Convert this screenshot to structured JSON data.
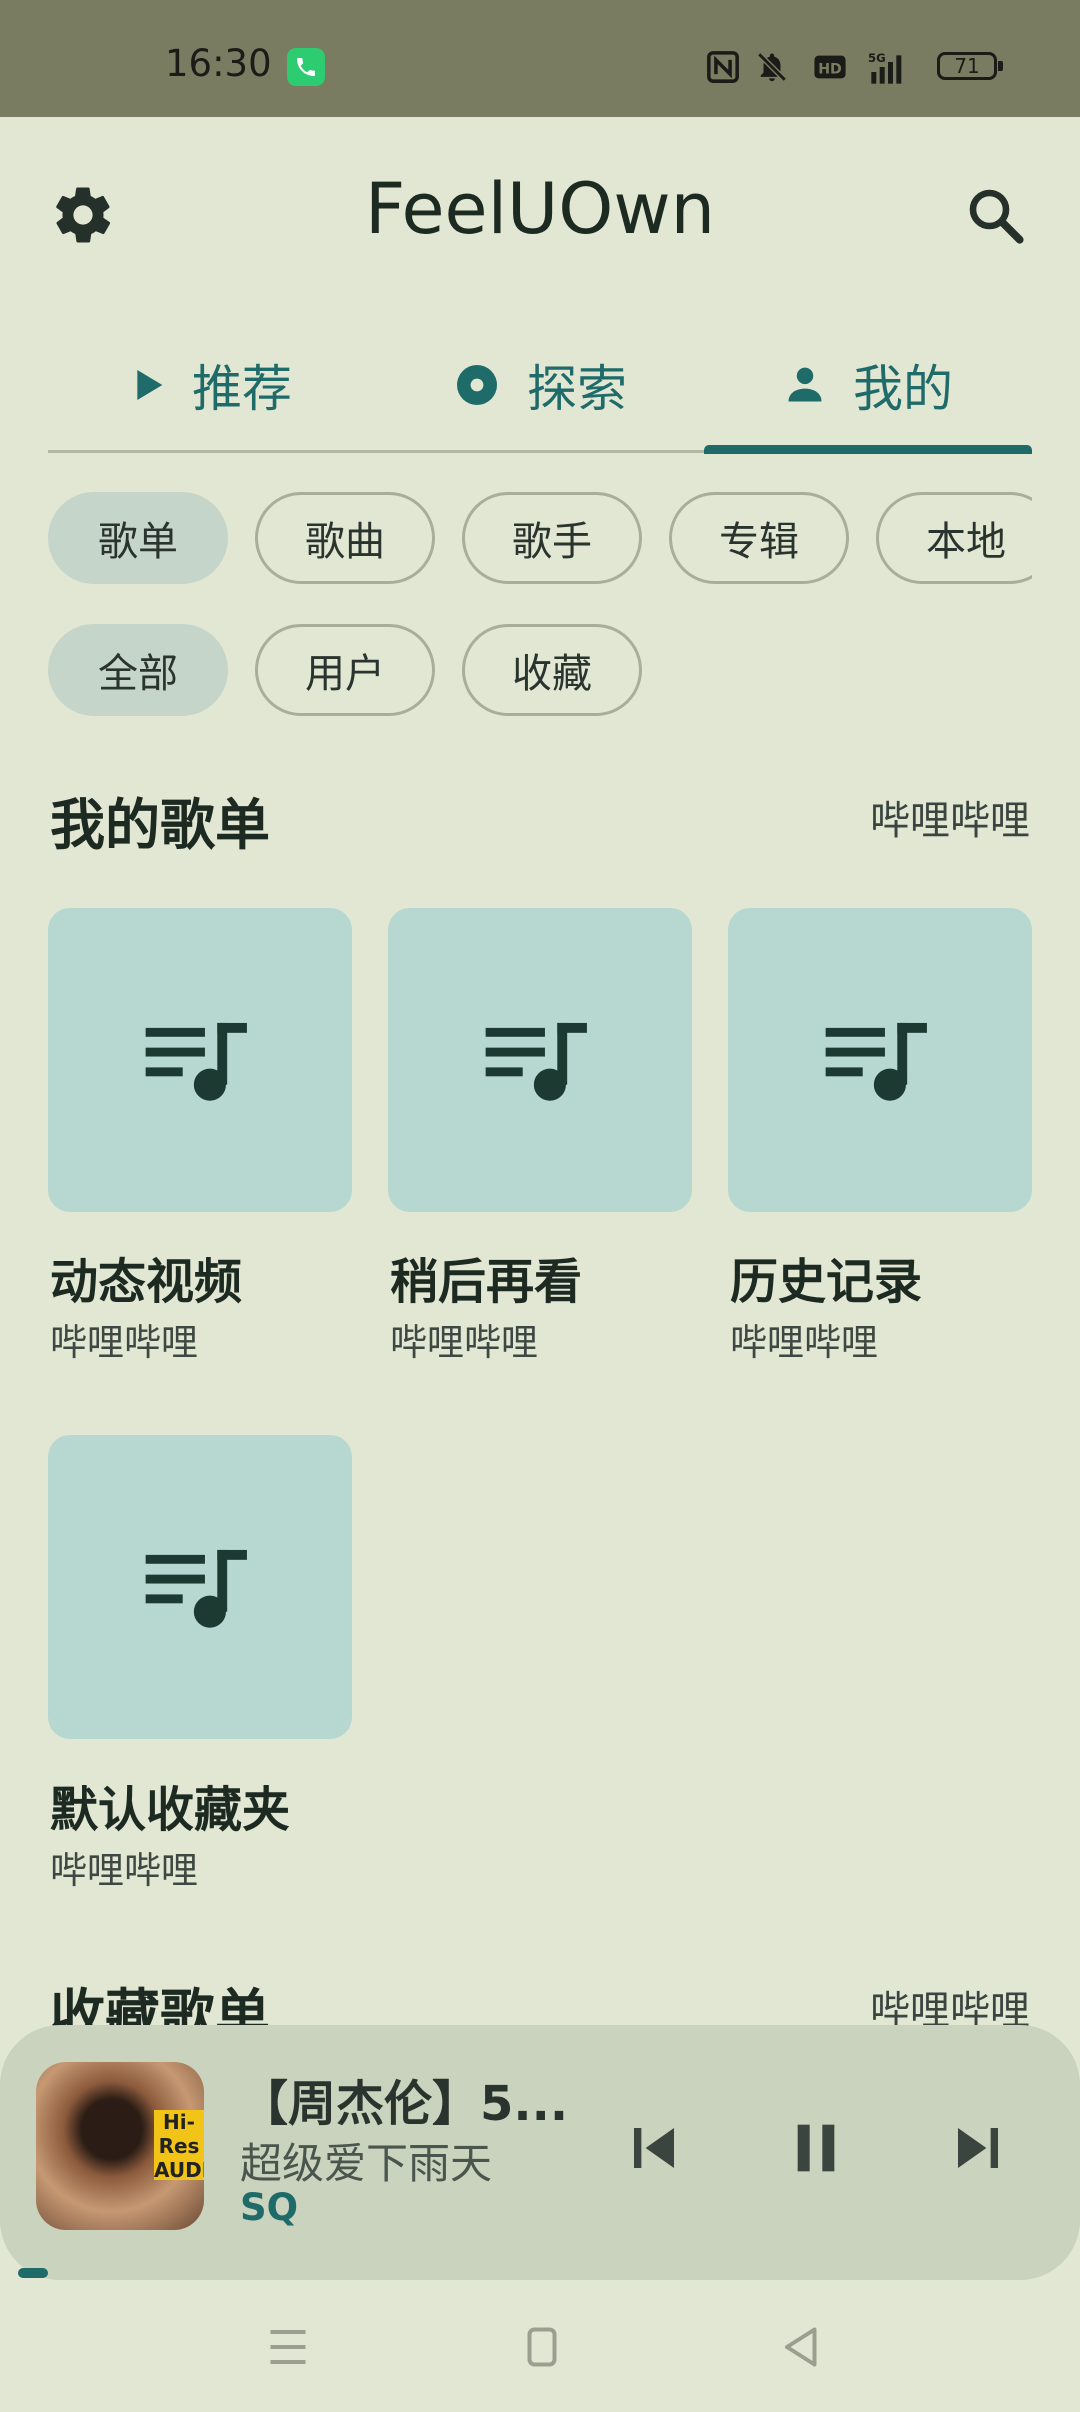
{
  "status_bar": {
    "time": "16:30",
    "network": "5G",
    "battery": "71",
    "icons": [
      "phone-call-icon",
      "nfc-icon",
      "bell-mute-icon",
      "hd-icon",
      "signal-5g-icon",
      "battery-icon"
    ]
  },
  "app_bar": {
    "title": "FeelUOwn",
    "settings_icon": "gear-icon",
    "search_icon": "search-icon"
  },
  "tabs": [
    {
      "label": "推荐",
      "icon": "play-icon",
      "selected": false
    },
    {
      "label": "探索",
      "icon": "disc-icon",
      "selected": false
    },
    {
      "label": "我的",
      "icon": "person-icon",
      "selected": true
    }
  ],
  "chips_row1": [
    {
      "label": "歌单",
      "selected": true
    },
    {
      "label": "歌曲",
      "selected": false
    },
    {
      "label": "歌手",
      "selected": false
    },
    {
      "label": "专辑",
      "selected": false
    },
    {
      "label": "本地",
      "selected": false
    }
  ],
  "chips_row2": [
    {
      "label": "全部",
      "selected": true
    },
    {
      "label": "用户",
      "selected": false
    },
    {
      "label": "收藏",
      "selected": false
    }
  ],
  "my_playlists": {
    "title": "我的歌单",
    "source_link": "哔哩哔哩",
    "items": [
      {
        "title": "动态视频",
        "subtitle": "哔哩哔哩"
      },
      {
        "title": "稍后再看",
        "subtitle": "哔哩哔哩"
      },
      {
        "title": "历史记录",
        "subtitle": "哔哩哔哩"
      },
      {
        "title": "默认收藏夹",
        "subtitle": "哔哩哔哩"
      }
    ]
  },
  "fav_playlists": {
    "title": "收藏歌单",
    "source_link": "哔哩哔哩"
  },
  "player": {
    "title": "【周杰伦】5...",
    "artist": "超级爱下雨天",
    "quality": "SQ",
    "badge": "Hi-Res AUDIO",
    "progress": 0.02
  },
  "colors": {
    "background": "#e2e7d3",
    "accent": "#1f6b6a",
    "status_bar": "#7a7c62",
    "card": "#b7d7d1",
    "chip_selected": "#c6d5ca",
    "player_bg": "#c9d3bd"
  }
}
